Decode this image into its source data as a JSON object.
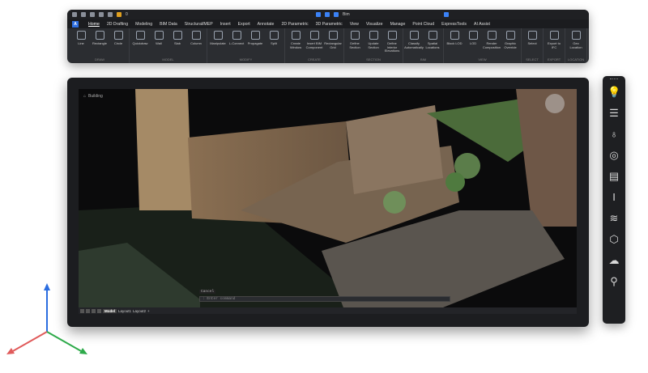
{
  "quick_access": {
    "layer": "0",
    "view": "Bim"
  },
  "tabs": [
    "Home",
    "2D Drafting",
    "Modeling",
    "BIM Data",
    "Structural/MEP",
    "Insert",
    "Export",
    "Annotate",
    "2D Parametric",
    "3D Parametric",
    "View",
    "Visualize",
    "Manage",
    "Point Cloud",
    "ExpressTools",
    "AI Assist"
  ],
  "active_tab": "Home",
  "groups": [
    {
      "name": "DRAW",
      "tools": [
        "Line",
        "Rectangle",
        "Circle"
      ]
    },
    {
      "name": "MODEL",
      "tools": [
        "Quickdraw",
        "Wall",
        "Slab",
        "Column"
      ]
    },
    {
      "name": "MODIFY",
      "tools": [
        "Manipulate",
        "L-Connect",
        "Propagate",
        "Split"
      ]
    },
    {
      "name": "CREATE",
      "tools": [
        "Create Window",
        "Insert BIM Component",
        "Rectangular Grid"
      ]
    },
    {
      "name": "SECTION",
      "tools": [
        "Define Section",
        "Update Section",
        "Define Interior Elevations"
      ]
    },
    {
      "name": "BIM",
      "tools": [
        "Classify Automatically",
        "Spatial Locations"
      ]
    },
    {
      "name": "VIEW",
      "tools": [
        "Block LOD",
        "LOD",
        "Render Composition",
        "Graphic Override"
      ]
    },
    {
      "name": "SELECT",
      "tools": [
        "Select"
      ]
    },
    {
      "name": "EXPORT",
      "tools": [
        "Export to IFC"
      ]
    },
    {
      "name": "LOCATION",
      "tools": [
        "Geo Location"
      ]
    }
  ],
  "viewport": {
    "breadcrumb": "Building",
    "cancel": "Cancel",
    "command_placeholder": ": Enter command"
  },
  "status": {
    "tabs": [
      "Model",
      "Layout1",
      "Layout2",
      "+"
    ]
  },
  "side_tools": [
    "lightbulb-icon",
    "sliders-icon",
    "balloon-icon",
    "scan-icon",
    "ruler-icon",
    "beam-icon",
    "layers-icon",
    "cube-icon",
    "cloud-upload-icon",
    "pin-icon"
  ],
  "side_glyphs": [
    "💡",
    "☰",
    "♁",
    "◎",
    "▤",
    "Ι",
    "≋",
    "⬡",
    "☁",
    "⚲"
  ]
}
